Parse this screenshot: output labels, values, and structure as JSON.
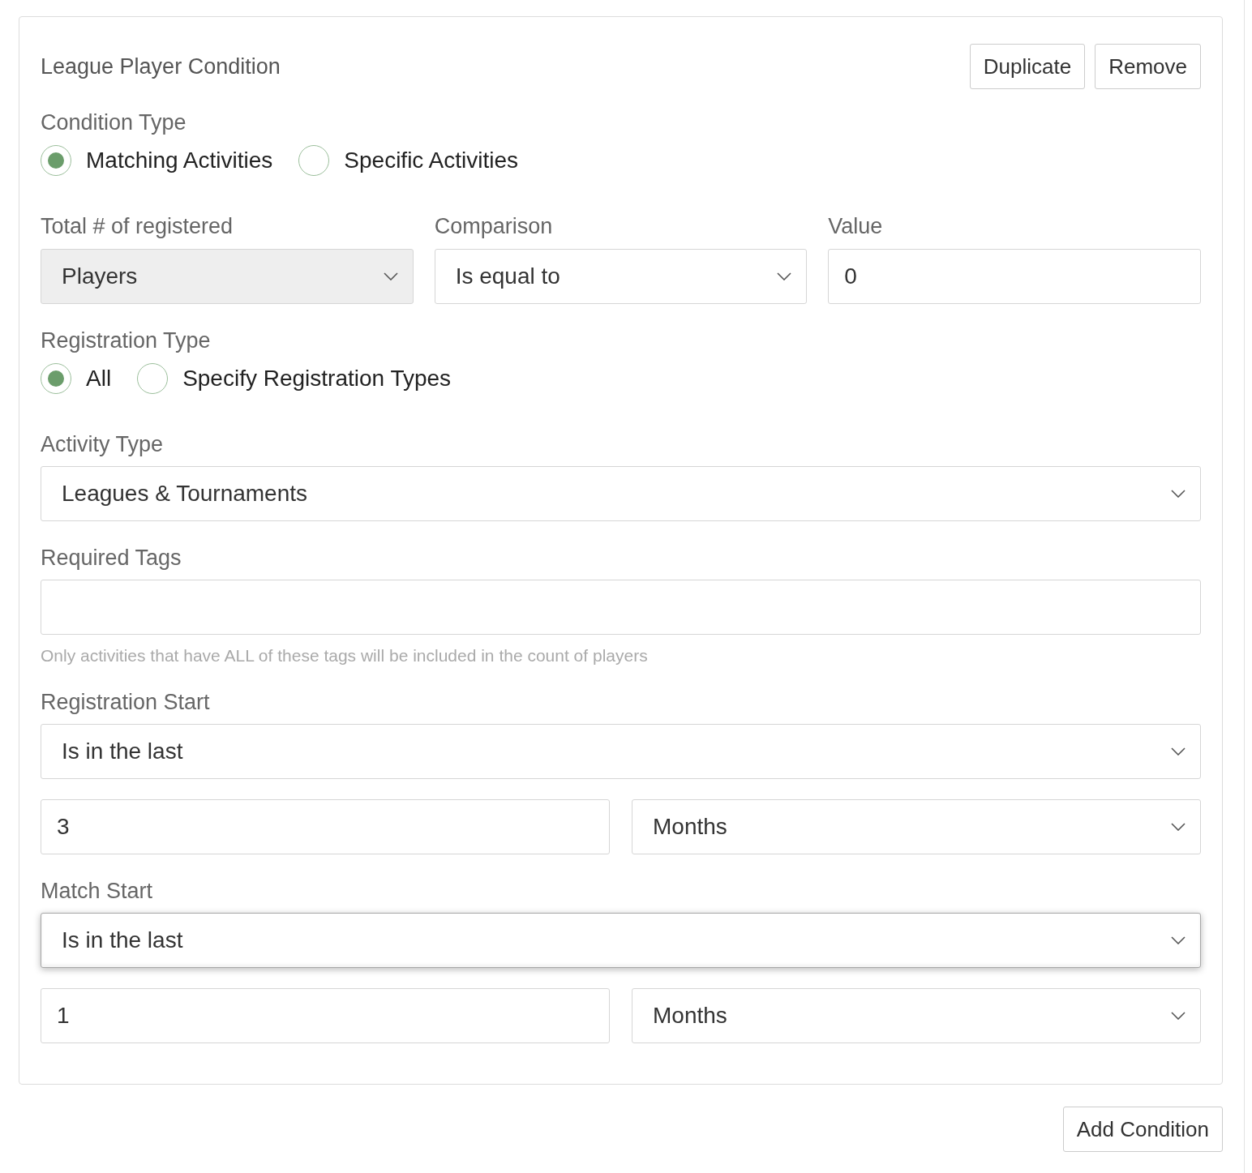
{
  "card": {
    "title": "League Player Condition",
    "buttons": [
      "Duplicate",
      "Remove"
    ]
  },
  "sections": [
    {
      "kind": "radio-group",
      "label": "Condition Type",
      "options": [
        {
          "label": "Matching Activities",
          "selected": true
        },
        {
          "label": "Specific Activities",
          "selected": false
        }
      ]
    },
    {
      "kind": "field-row",
      "fields": [
        {
          "label": "Total # of registered",
          "kind": "select",
          "value": "Players",
          "disabled": true
        },
        {
          "label": "Comparison",
          "kind": "select",
          "value": "Is equal to",
          "disabled": false
        },
        {
          "label": "Value",
          "kind": "input",
          "value": "0",
          "disabled": false
        }
      ]
    },
    {
      "kind": "radio-group",
      "label": "Registration Type",
      "options": [
        {
          "label": "All",
          "selected": true
        },
        {
          "label": "Specify Registration Types",
          "selected": false
        }
      ]
    },
    {
      "kind": "field",
      "label": "Activity Type",
      "control": {
        "kind": "select",
        "value": "Leagues & Tournaments"
      }
    },
    {
      "kind": "field",
      "label": "Required Tags",
      "control": {
        "kind": "input"
      },
      "help": "Only activities that have ALL of these tags will be included in the count of players"
    },
    {
      "kind": "date-range",
      "label": "Registration Start",
      "operator": {
        "value": "Is in the last",
        "focused": false
      },
      "amount": "3",
      "unit": "Months"
    },
    {
      "kind": "date-range",
      "label": "Match Start",
      "operator": {
        "value": "Is in the last",
        "focused": true
      },
      "amount": "1",
      "unit": "Months"
    }
  ],
  "footer": {
    "button": "Add Condition"
  }
}
